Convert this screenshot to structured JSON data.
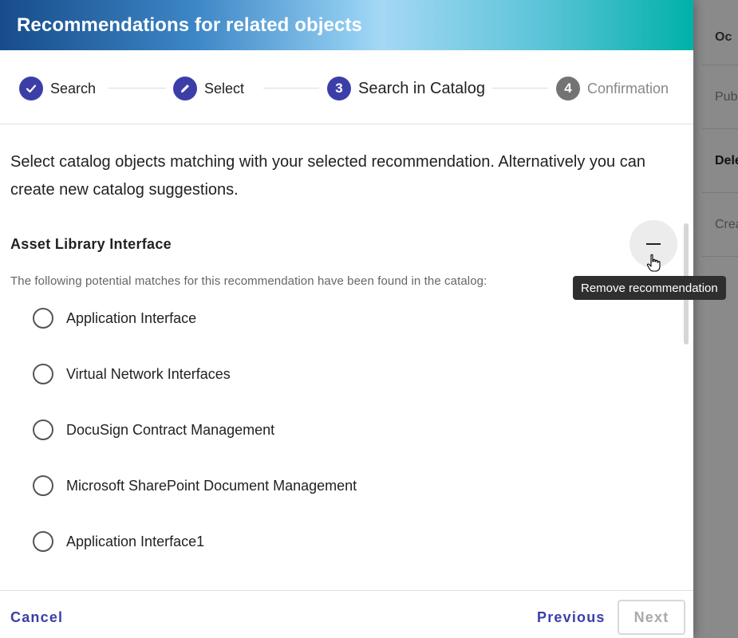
{
  "background": {
    "rows": [
      "Oc",
      "Pub",
      "Dele",
      "Crea"
    ]
  },
  "dialog": {
    "title": "Recommendations for related objects",
    "stepper": {
      "steps": [
        {
          "label": "Search",
          "state": "done",
          "icon": "check-icon"
        },
        {
          "label": "Select",
          "state": "done",
          "icon": "pencil-icon"
        },
        {
          "label": "Search in Catalog",
          "state": "active",
          "number": "3"
        },
        {
          "label": "Confirmation",
          "state": "inactive",
          "number": "4"
        }
      ]
    },
    "intro": "Select catalog objects matching with your selected recommendation. Alternatively you can create new catalog suggestions.",
    "section": {
      "title": "Asset Library Interface",
      "remove_icon": "minus-icon",
      "tooltip": "Remove recommendation",
      "hint": "The following potential matches for this recommendation have been found in the catalog:",
      "options": [
        "Application Interface",
        "Virtual Network Interfaces",
        "DocuSign Contract Management",
        "Microsoft SharePoint Document Management",
        "Application Interface1"
      ]
    },
    "footer": {
      "cancel_label": "Cancel",
      "previous_label": "Previous",
      "next_label": "Next"
    }
  },
  "colors": {
    "accent": "#3c3ea8",
    "inactive_step": "#737373",
    "tooltip_bg": "#2f2f2f"
  }
}
